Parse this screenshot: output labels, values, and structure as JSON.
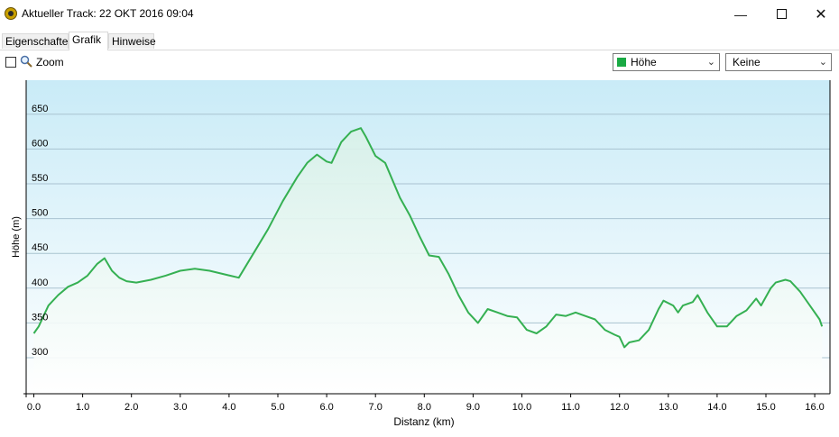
{
  "window": {
    "title": "Aktueller Track: 22 OKT 2016 09:04"
  },
  "tabs": [
    {
      "label": "Eigenschaften"
    },
    {
      "label": "Grafik"
    },
    {
      "label": "Hinweise"
    }
  ],
  "toolbar": {
    "zoom_label": "Zoom",
    "zoom_checked": false,
    "series_select": "Höhe",
    "second_select": "Keine"
  },
  "colors": {
    "line": "#35b052",
    "fill_top": "#d8f1e8",
    "plot_top": "#c9ebf7",
    "plot_bottom": "#ffffff"
  },
  "chart_data": {
    "type": "area",
    "xlabel": "Distanz  (km)",
    "ylabel": "Höhe (m)",
    "x_ticks": [
      "0.0",
      "1.0",
      "2.0",
      "3.0",
      "4.0",
      "5.0",
      "6.0",
      "7.0",
      "8.0",
      "9.0",
      "10.0",
      "11.0",
      "12.0",
      "13.0",
      "14.0",
      "15.0",
      "16.0"
    ],
    "y_ticks": [
      "300",
      "350",
      "400",
      "450",
      "500",
      "550",
      "600",
      "650"
    ],
    "xlim": [
      0,
      16.2
    ],
    "ylim": [
      240,
      700
    ],
    "series": [
      {
        "x": [
          0.0,
          0.1,
          0.2,
          0.3,
          0.5,
          0.7,
          0.9,
          1.1,
          1.3,
          1.45,
          1.6,
          1.75,
          1.9,
          2.1,
          2.4,
          2.7,
          3.0,
          3.3,
          3.6,
          3.9,
          4.2,
          4.5,
          4.8,
          5.1,
          5.4,
          5.6,
          5.8,
          6.0,
          6.1,
          6.3,
          6.5,
          6.7,
          6.8,
          7.0,
          7.2,
          7.5,
          7.7,
          7.9,
          8.1,
          8.3,
          8.5,
          8.7,
          8.9,
          9.1,
          9.3,
          9.5,
          9.7,
          9.9,
          10.1,
          10.3,
          10.5,
          10.7,
          10.9,
          11.1,
          11.3,
          11.5,
          11.7,
          11.9,
          12.0,
          12.1,
          12.2,
          12.4,
          12.6,
          12.8,
          12.9,
          13.1,
          13.2,
          13.3,
          13.5,
          13.6,
          13.8,
          14.0,
          14.2,
          14.4,
          14.6,
          14.8,
          14.9,
          15.1,
          15.2,
          15.4,
          15.5,
          15.7,
          15.9,
          16.1,
          16.15
        ],
        "y": [
          335,
          345,
          360,
          375,
          390,
          402,
          408,
          418,
          435,
          443,
          425,
          415,
          410,
          408,
          412,
          418,
          425,
          428,
          425,
          420,
          415,
          450,
          485,
          525,
          560,
          580,
          592,
          582,
          580,
          610,
          625,
          630,
          618,
          590,
          580,
          530,
          505,
          475,
          447,
          445,
          420,
          390,
          365,
          350,
          370,
          365,
          360,
          358,
          340,
          335,
          345,
          362,
          360,
          365,
          360,
          355,
          340,
          333,
          330,
          315,
          322,
          325,
          340,
          370,
          382,
          375,
          365,
          375,
          380,
          390,
          365,
          345,
          345,
          360,
          368,
          385,
          375,
          400,
          408,
          412,
          410,
          395,
          375,
          355,
          345
        ]
      }
    ]
  }
}
